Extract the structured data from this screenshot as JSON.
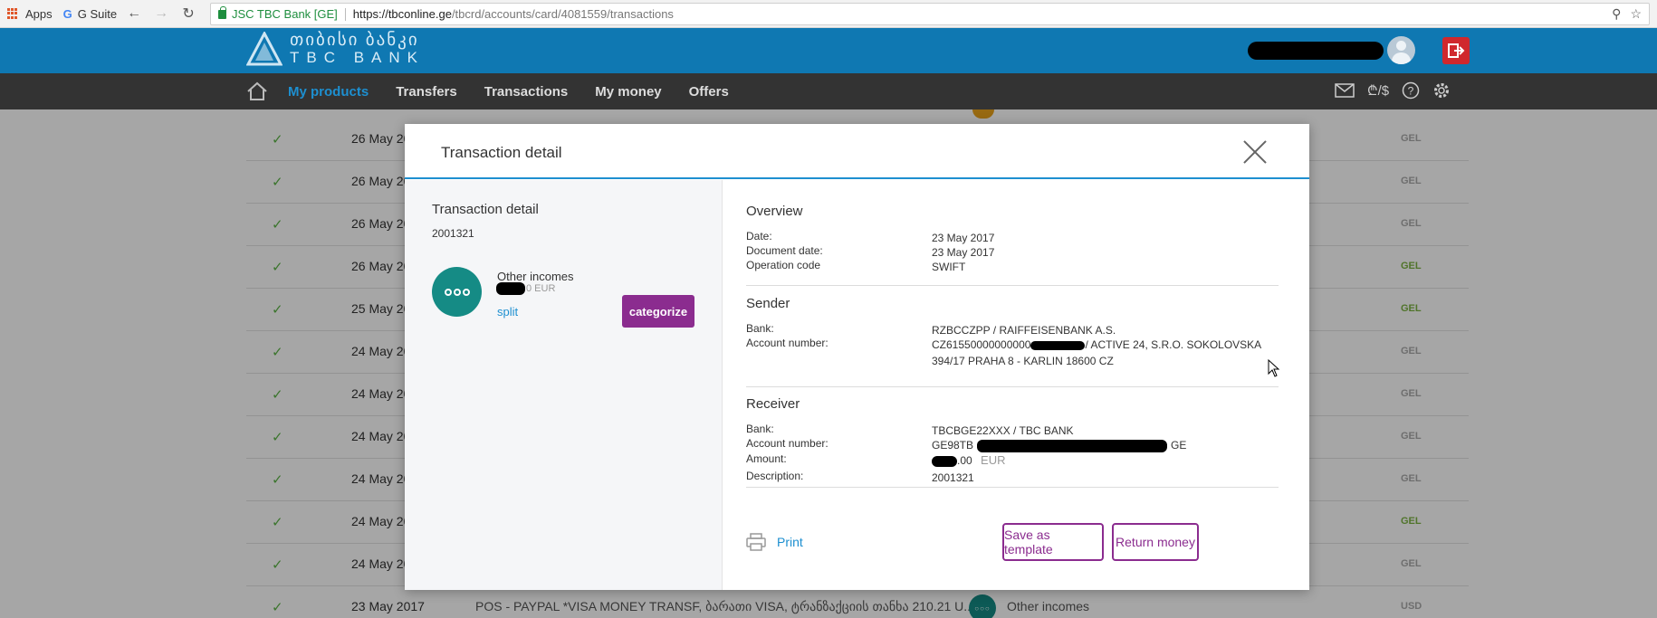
{
  "browser": {
    "bookmarks": {
      "apps": "Apps",
      "gsuite": "G Suite"
    },
    "secure_label": "JSC TBC Bank [GE]",
    "url_host": "https://tbconline.ge",
    "url_path": "/tbcrd/accounts/card/4081559/transactions"
  },
  "bank": {
    "logo_ge": "თიბისი ბანკი",
    "logo_en": "TBC BANK"
  },
  "nav": {
    "items": [
      "My products",
      "Transfers",
      "Transactions",
      "My money",
      "Offers"
    ],
    "active": "My products",
    "currency_icon_text": "₾/$"
  },
  "background_rows": [
    {
      "date": "26 May 20",
      "currency": "GEL",
      "green": false
    },
    {
      "date": "26 May 20",
      "currency": "GEL",
      "green": false
    },
    {
      "date": "26 May 20",
      "currency": "GEL",
      "green": false
    },
    {
      "date": "26 May 20",
      "currency": "GEL",
      "green": true
    },
    {
      "date": "25 May 20",
      "currency": "GEL",
      "green": true
    },
    {
      "date": "24 May 20",
      "currency": "GEL",
      "green": false
    },
    {
      "date": "24 May 20",
      "currency": "GEL",
      "green": false
    },
    {
      "date": "24 May 20",
      "currency": "GEL",
      "green": false
    },
    {
      "date": "24 May 20",
      "currency": "GEL",
      "green": false
    },
    {
      "date": "24 May 20",
      "currency": "GEL",
      "green": true
    },
    {
      "date": "24 May 20",
      "currency": "GEL",
      "green": false
    }
  ],
  "last_row": {
    "date": "23 May 2017",
    "description": "POS - PAYPAL *VISA MONEY TRANSF, ბარათი VISA, ტრანზაქციის თანხა 210.21 U...",
    "category": "Other incomes",
    "currency": "USD"
  },
  "modal": {
    "title": "Transaction detail",
    "left": {
      "title": "Transaction detail",
      "id": "2001321",
      "category": "Other incomes",
      "amount_suffix": "0 EUR",
      "split_label": "split",
      "categorize_label": "categorize"
    },
    "overview": {
      "heading": "Overview",
      "rows": [
        {
          "k": "Date:",
          "v": "23 May 2017"
        },
        {
          "k": "Document date:",
          "v": "23 May 2017"
        },
        {
          "k": "Operation code",
          "v": "SWIFT"
        }
      ]
    },
    "sender": {
      "heading": "Sender",
      "bank_label": "Bank:",
      "bank_value": "RZBCCZPP / RAIFFEISENBANK A.S.",
      "account_label": "Account number:",
      "account_prefix": "CZ61550000000000",
      "account_rest": "/ ACTIVE 24, S.R.O. SOKOLOVSKA",
      "account_line2": "394/17 PRAHA 8 - KARLIN 18600 CZ"
    },
    "receiver": {
      "heading": "Receiver",
      "bank_label": "Bank:",
      "bank_value": "TBCBGE22XXX / TBC BANK",
      "account_label": "Account number:",
      "account_prefix": "GE98TB",
      "account_suffix": "GE",
      "amount_label": "Amount:",
      "amount_value": ".00",
      "amount_currency": "EUR",
      "description_label": "Description:",
      "description_value": "2001321"
    },
    "print_label": "Print",
    "save_template_label": "Save as template",
    "return_money_label": "Return money"
  }
}
